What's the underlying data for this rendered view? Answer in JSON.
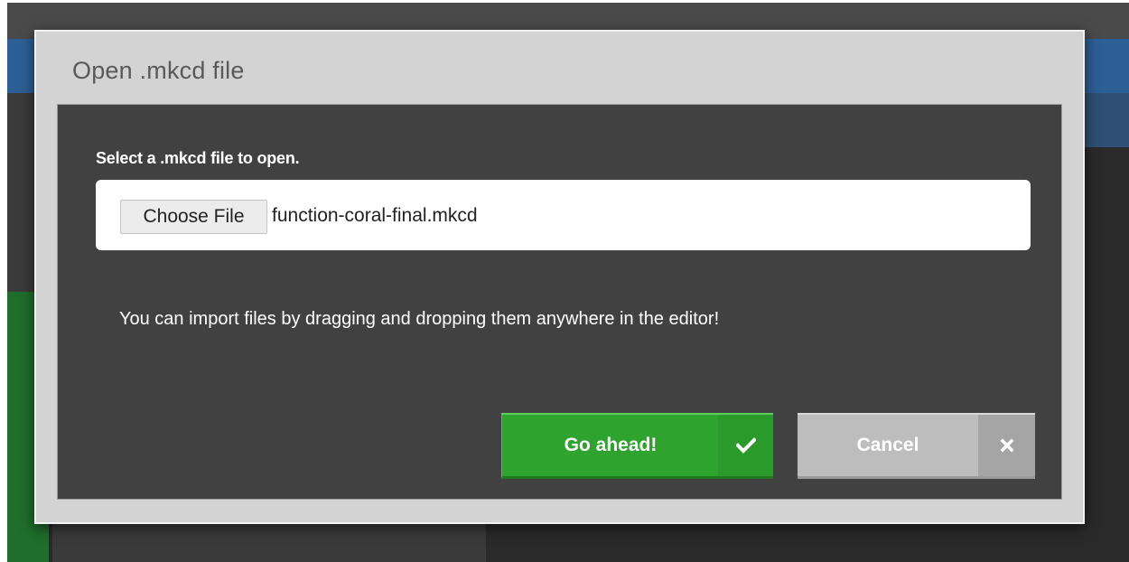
{
  "dialog": {
    "title": "Open .mkcd file",
    "select_label": "Select a .mkcd file to open.",
    "choose_file_label": "Choose File",
    "file_name": "function-coral-final.mkcd",
    "hint": "You can import files by dragging and dropping them anywhere in the editor!",
    "confirm_label": "Go ahead!",
    "confirm_icon": "check-icon",
    "cancel_label": "Cancel",
    "cancel_icon": "close-icon"
  },
  "colors": {
    "dialog_frame": "#d3d3d3",
    "dialog_body": "#414141",
    "confirm": "#2ea32e",
    "cancel": "#bdbdbd",
    "title_text": "#595959"
  }
}
